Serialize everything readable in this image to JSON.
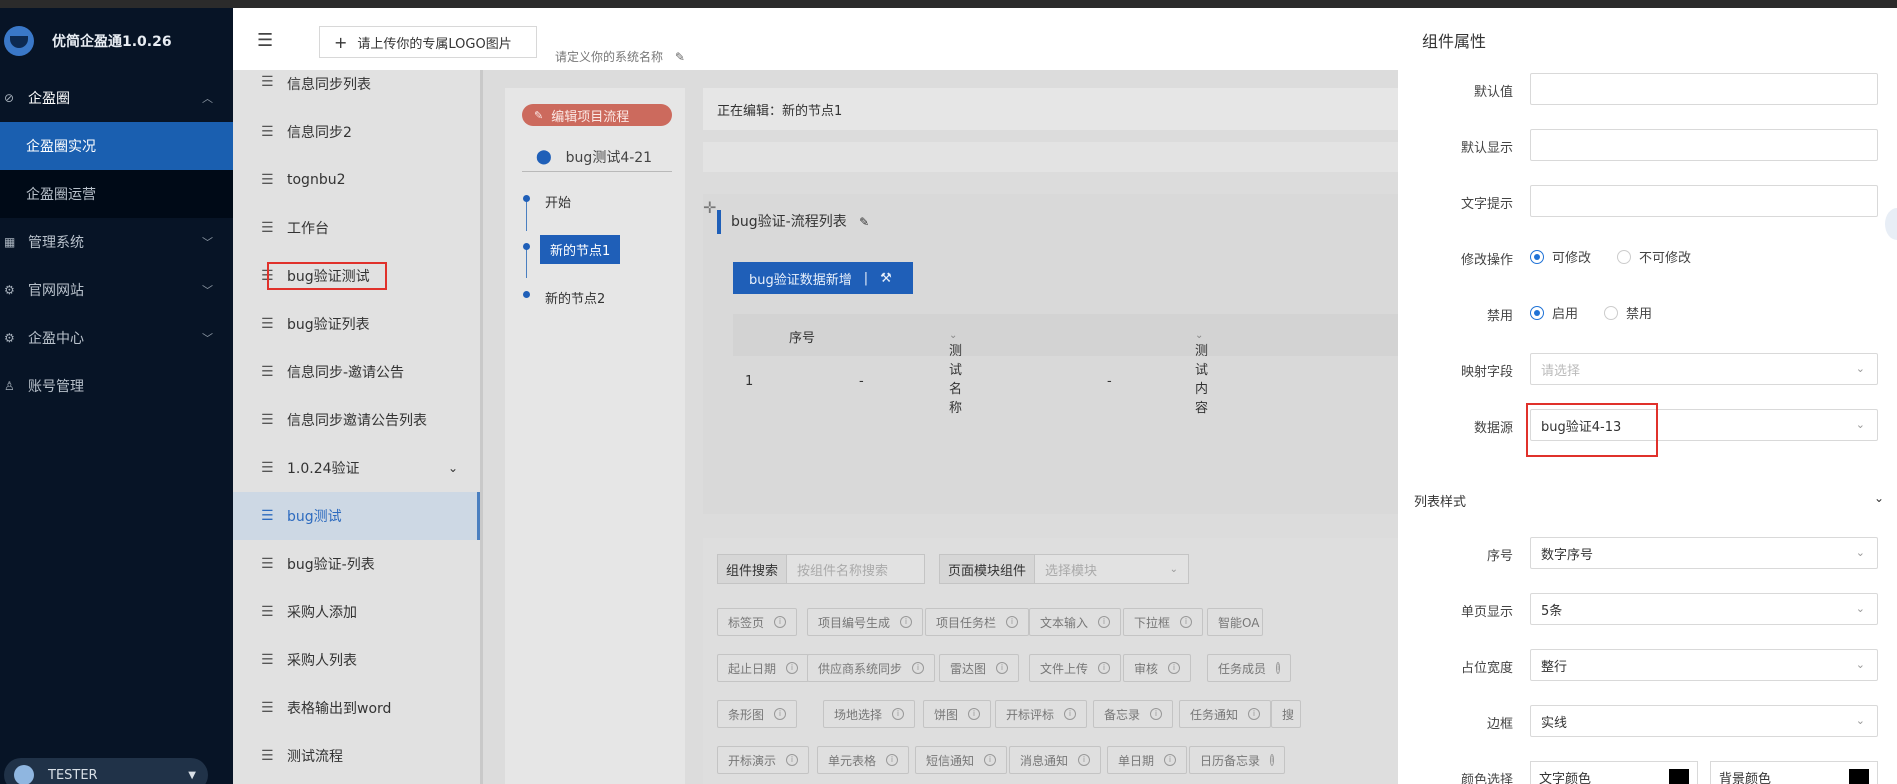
{
  "app": {
    "title": "优简企盈通1.0.26"
  },
  "nav": {
    "items": [
      {
        "label": "企盈圈",
        "icon": "compass-icon",
        "open": true
      },
      {
        "label": "管理系统",
        "icon": "grid-icon"
      },
      {
        "label": "官网网站",
        "icon": "gear-icon"
      },
      {
        "label": "企盈中心",
        "icon": "gear-icon"
      },
      {
        "label": "账号管理",
        "icon": "user-icon"
      }
    ],
    "sub_items": [
      {
        "label": "企盈圈实况",
        "active": true
      },
      {
        "label": "企盈圈运营"
      }
    ],
    "user": "TESTER"
  },
  "header": {
    "logo_button": "请上传你的专属LOGO图片",
    "system_name_placeholder": "请定义你的系统名称"
  },
  "list": {
    "items": [
      "信息同步列表",
      "信息同步2",
      "tognbu2",
      "工作台",
      "bug验证测试",
      "bug验证列表",
      "信息同步-邀请公告",
      "信息同步邀请公告列表",
      "1.0.24验证",
      "bug测试",
      "bug验证-列表",
      "采购人添加",
      "采购人列表",
      "表格输出到word",
      "测试流程"
    ],
    "active_index": 9
  },
  "flow": {
    "edit_button": "编辑项目流程",
    "project": "bug测试4-21",
    "nodes": [
      "开始",
      "新的节点1",
      "新的节点2"
    ],
    "active_node": 1
  },
  "editor": {
    "editing_label": "正在编辑：新的节点1",
    "component_title": "bug验证-流程列表",
    "add_button": "bug验证数据新增",
    "columns": [
      "序号",
      "测试名称",
      "测试内容"
    ],
    "rows": [
      [
        "1",
        "-",
        "-"
      ]
    ],
    "search": {
      "label": "组件搜索",
      "placeholder": "按组件名称搜索",
      "module_label": "页面模块组件",
      "module_placeholder": "选择模块"
    },
    "chips": [
      [
        "标签页",
        "项目编号生成",
        "项目任务栏",
        "文本输入",
        "下拉框",
        "智能OA"
      ],
      [
        "起止日期",
        "供应商系统同步",
        "雷达图",
        "文件上传",
        "审核",
        "任务成员"
      ],
      [
        "条形图",
        "场地选择",
        "饼图",
        "开标评标",
        "备忘录",
        "任务通知",
        "搜"
      ],
      [
        "开标演示",
        "单元表格",
        "短信通知",
        "消息通知",
        "单日期",
        "日历备忘录"
      ]
    ]
  },
  "drawer": {
    "title": "组件属性",
    "fields": {
      "default_value": {
        "label": "默认值",
        "value": ""
      },
      "default_display": {
        "label": "默认显示",
        "value": ""
      },
      "text_hint": {
        "label": "文字提示",
        "value": ""
      },
      "modify": {
        "label": "修改操作",
        "options": [
          "可修改",
          "不可修改"
        ],
        "selected": 0
      },
      "disabled": {
        "label": "禁用",
        "options": [
          "启用",
          "禁用"
        ],
        "selected": 0
      },
      "mapping": {
        "label": "映射字段",
        "placeholder": "请选择"
      },
      "datasource": {
        "label": "数据源",
        "value": "bug验证4-13"
      }
    },
    "section_title": "列表样式",
    "style_fields": {
      "serial": {
        "label": "序号",
        "value": "数字序号"
      },
      "page_size": {
        "label": "单页显示",
        "value": "5条"
      },
      "width": {
        "label": "占位宽度",
        "value": "整行"
      },
      "border": {
        "label": "边框",
        "value": "实线"
      },
      "color": {
        "label": "颜色选择",
        "text_color_label": "文字颜色",
        "bg_color_label": "背景颜色",
        "text_color": "#000000",
        "bg_color": "#000000"
      }
    }
  },
  "colors": {
    "nav_bg": "#071426",
    "accent": "#1a5fb0",
    "highlight": "#e0312b"
  }
}
